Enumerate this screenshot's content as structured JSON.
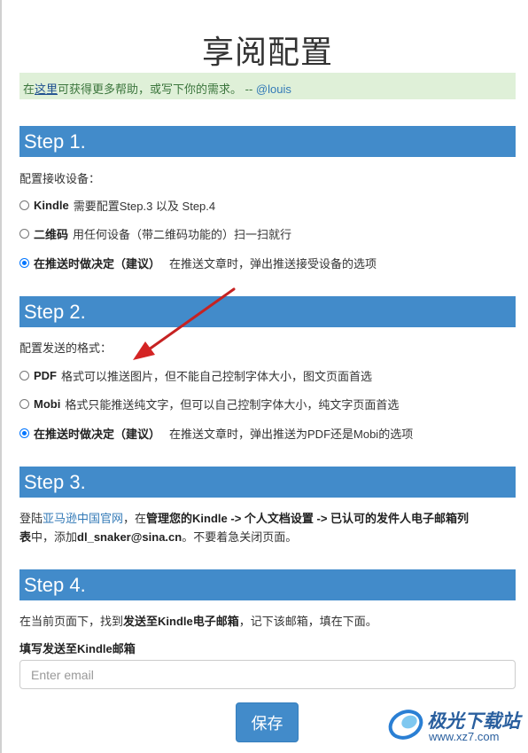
{
  "title": "享阅配置",
  "help": {
    "prefix": "在",
    "here_link": "这里",
    "middle": "可获得更多帮助，或写下你的需求。 -- ",
    "author_link": "@louis"
  },
  "step1": {
    "header": "Step 1.",
    "label": "配置接收设备：",
    "options": [
      {
        "bold": "Kindle",
        "text": "需要配置Step.3 以及 Step.4",
        "checked": false
      },
      {
        "bold": "二维码",
        "text": "用任何设备（带二维码功能的）扫一扫就行",
        "checked": false
      },
      {
        "bold": "在推送时做决定（建议）",
        "text": "在推送文章时，弹出推送接受设备的选项",
        "checked": true
      }
    ]
  },
  "step2": {
    "header": "Step 2.",
    "label": "配置发送的格式：",
    "options": [
      {
        "bold": "PDF",
        "text": "格式可以推送图片，但不能自己控制字体大小，图文页面首选",
        "checked": false
      },
      {
        "bold": "Mobi",
        "text": "格式只能推送纯文字，但可以自己控制字体大小，纯文字页面首选",
        "checked": false
      },
      {
        "bold": "在推送时做决定（建议）",
        "text": "在推送文章时，弹出推送为PDF还是Mobi的选项",
        "checked": true
      }
    ]
  },
  "step3": {
    "header": "Step 3.",
    "line1_prefix": "登陆",
    "line1_link": "亚马逊中国官网",
    "line1_mid": "，在",
    "line1_bold": "管理您的Kindle -> 个人文档设置 -> 已认可的发件人电子邮箱列",
    "line2_bold1": "表",
    "line2_mid": "中，添加",
    "line2_bold2": "dl_snaker@sina.cn",
    "line2_suffix": "。不要着急关闭页面。"
  },
  "step4": {
    "header": "Step 4.",
    "line_prefix": "在当前页面下，找到",
    "line_bold": "发送至Kindle电子邮箱",
    "line_suffix": "，记下该邮箱，填在下面。",
    "email_label": "填写发送至Kindle邮箱",
    "email_value": "",
    "email_placeholder": "Enter email",
    "save_label": "保存"
  },
  "watermark": {
    "name": "极光下载站",
    "url": "www.xz7.com"
  },
  "colors": {
    "step_header_bg": "#428bca",
    "help_bg": "#dff0d8",
    "arrow": "#cc2222"
  }
}
